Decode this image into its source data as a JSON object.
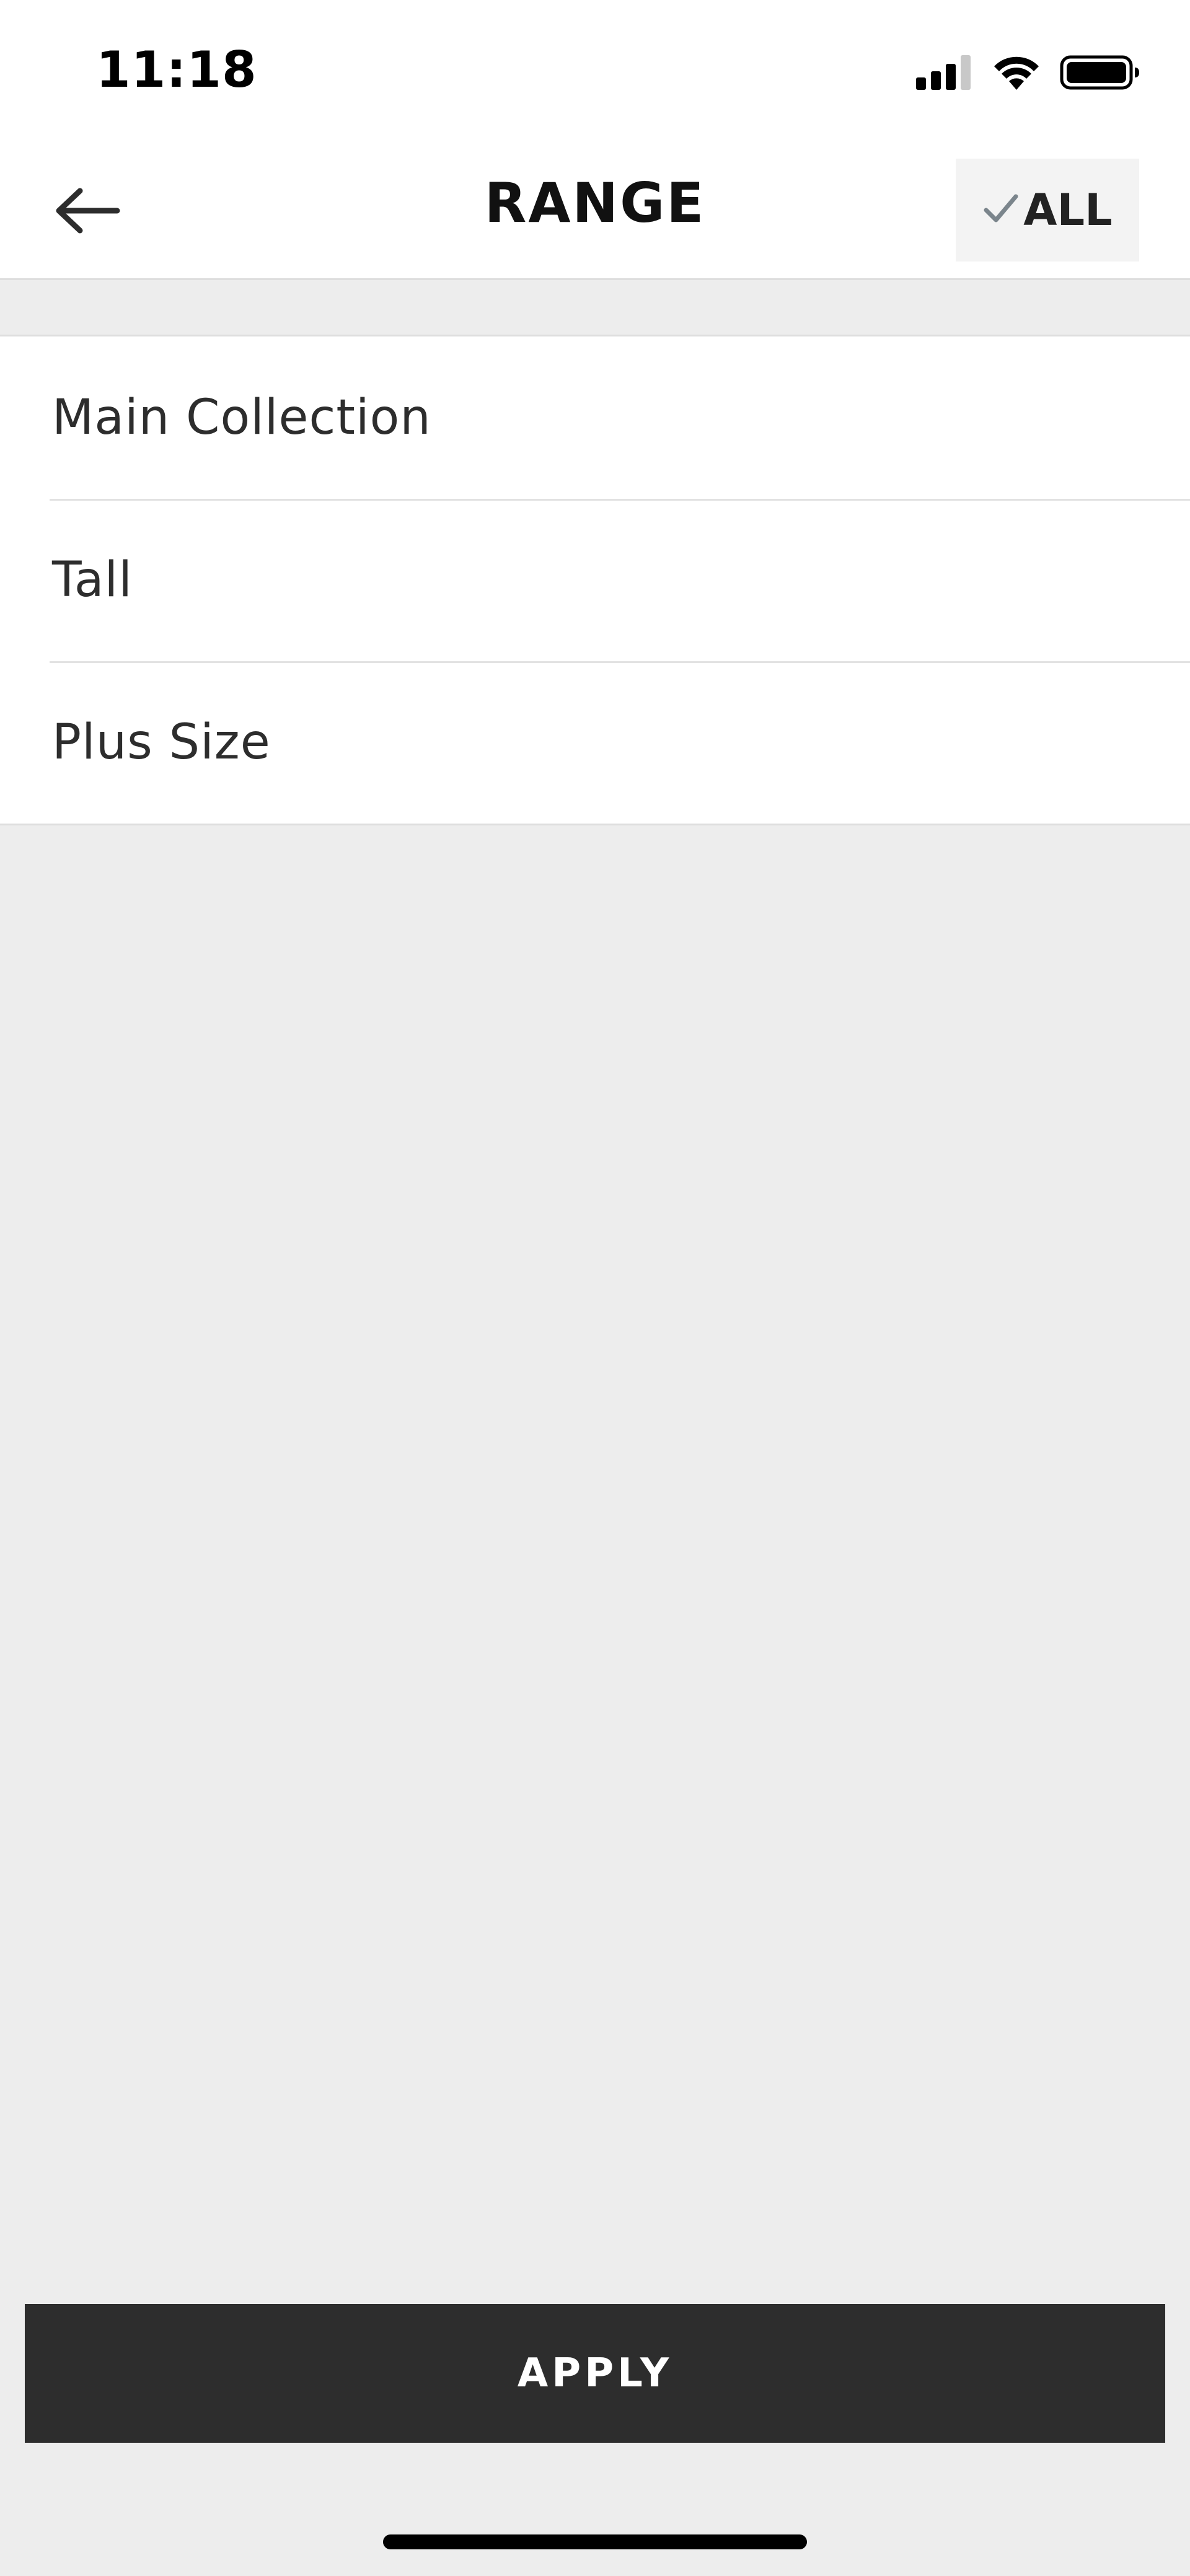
{
  "status_bar": {
    "time": "11:18",
    "icons": [
      "cellular-signal-icon",
      "wifi-icon",
      "battery-icon"
    ]
  },
  "nav": {
    "back_icon": "arrow-left-icon",
    "title": "RANGE",
    "all_button": {
      "icon": "checkmark-icon",
      "label": "ALL"
    }
  },
  "filters": {
    "items": [
      {
        "label": "Main Collection"
      },
      {
        "label": "Tall"
      },
      {
        "label": "Plus Size"
      }
    ]
  },
  "footer": {
    "apply_label": "APPLY"
  },
  "colors": {
    "background": "#ededed",
    "surface": "#ffffff",
    "primary_button": "#2d2d2d",
    "text": "#2d2d2d",
    "check_icon": "#7b858c"
  }
}
